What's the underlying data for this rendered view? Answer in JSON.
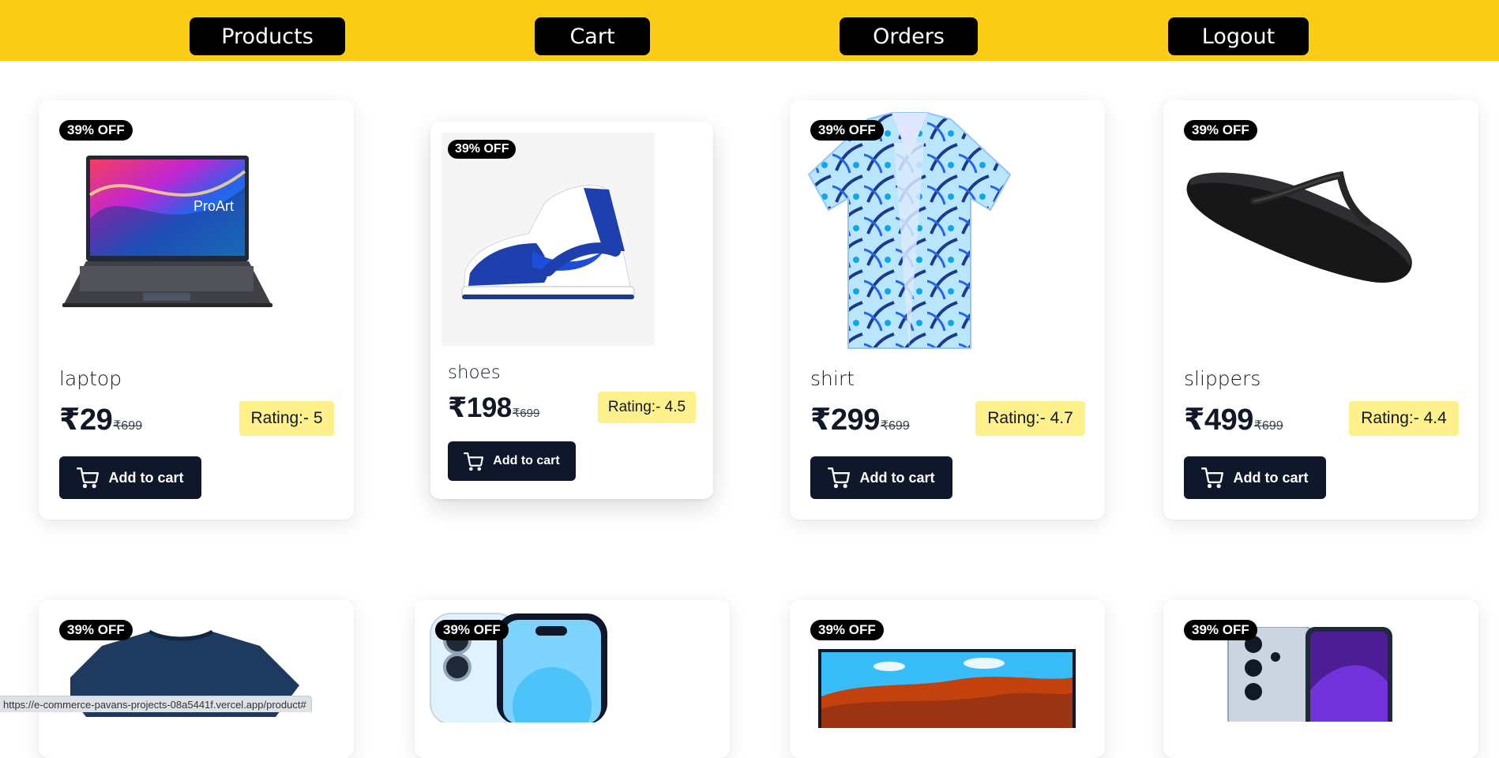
{
  "nav": {
    "products": "Products",
    "cart": "Cart",
    "orders": "Orders",
    "logout": "Logout"
  },
  "products": [
    {
      "badge": "39% OFF",
      "name": "laptop",
      "price": "₹29",
      "old_price": "₹699",
      "rating": "Rating:- 5",
      "button": "Add to cart"
    },
    {
      "badge": "39% OFF",
      "name": "shoes",
      "price": "₹198",
      "old_price": "₹699",
      "rating": "Rating:- 4.5",
      "button": "Add to cart"
    },
    {
      "badge": "39% OFF",
      "name": "shirt",
      "price": "₹299",
      "old_price": "₹699",
      "rating": "Rating:- 4.7",
      "button": "Add to cart"
    },
    {
      "badge": "39% OFF",
      "name": "slippers",
      "price": "₹499",
      "old_price": "₹699",
      "rating": "Rating:- 4.4",
      "button": "Add to cart"
    },
    {
      "badge": "39% OFF"
    },
    {
      "badge": "39% OFF"
    },
    {
      "badge": "39% OFF"
    },
    {
      "badge": "39% OFF"
    }
  ],
  "status_url": "https://e-commerce-pavans-projects-08a5441f.vercel.app/product#",
  "colors": {
    "header": "#facc15",
    "nav_button": "#000000",
    "rating_bg": "#fef08a",
    "cart_button": "#0f172a"
  }
}
